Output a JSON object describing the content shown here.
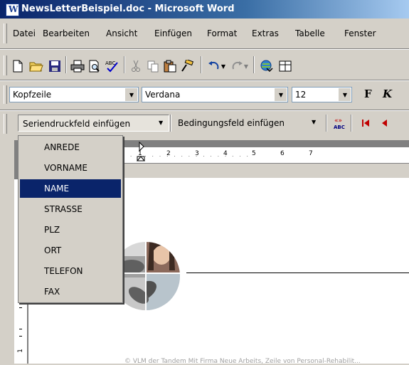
{
  "window": {
    "title": "NewsLetterBeispiel.doc - Microsoft Word",
    "app_icon": "word-doc-icon"
  },
  "menu": [
    "Datei",
    "Bearbeiten",
    "Ansicht",
    "Einfügen",
    "Format",
    "Extras",
    "Tabelle",
    "Fenster"
  ],
  "formatting": {
    "style": "Kopfzeile",
    "font": "Verdana",
    "size": "12",
    "bold": "F",
    "italic": "K"
  },
  "mailmerge": {
    "insert_field": "Seriendruckfeld einfügen",
    "condition_field": "Bedingungsfeld einfügen",
    "abc_label": "ABC"
  },
  "dropdown": {
    "items": [
      "ANREDE",
      "VORNAME",
      "NAME",
      "STRASSE",
      "PLZ",
      "ORT",
      "TELEFON",
      "FAX"
    ],
    "selected": "NAME"
  },
  "ruler": {
    "labels": [
      "1",
      "2",
      "3",
      "4",
      "5",
      "6",
      "7"
    ]
  },
  "footer": "© VLM der Tandem Mit Firma Neue Arbeits, Zeile von Personal-Rehabilit..."
}
